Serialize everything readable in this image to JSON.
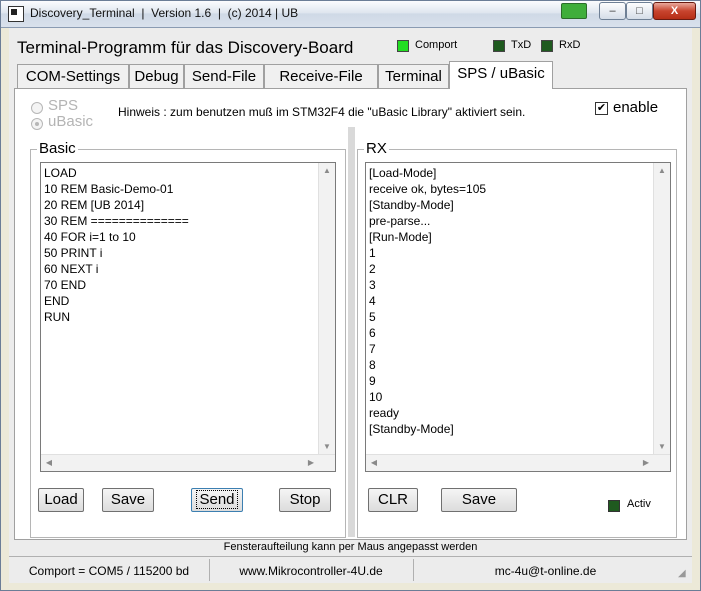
{
  "window": {
    "title": "Discovery_Terminal  |  Version 1.6  |  (c) 2014 | UB",
    "min_label": "–",
    "max_label": "□",
    "close_label": "X"
  },
  "header": {
    "app_title": "Terminal-Programm für das Discovery-Board",
    "indicators": [
      {
        "label": "Comport",
        "color": "#22dd22"
      },
      {
        "label": "TxD",
        "color": "#1f5a1f"
      },
      {
        "label": "RxD",
        "color": "#1f5a1f"
      }
    ]
  },
  "tabs": [
    {
      "label": "COM-Settings"
    },
    {
      "label": "Debug"
    },
    {
      "label": "Send-File"
    },
    {
      "label": "Receive-File"
    },
    {
      "label": "Terminal"
    },
    {
      "label": "SPS / uBasic",
      "active": true
    }
  ],
  "mode": {
    "options": [
      {
        "label": "SPS",
        "checked": false
      },
      {
        "label": "uBasic",
        "checked": true
      }
    ],
    "hint": "Hinweis : zum benutzen muß im STM32F4 die \"uBasic Library\" aktiviert sein.",
    "enable_label": "enable",
    "enable_checked": true,
    "check_glyph": "✔"
  },
  "basic": {
    "title": "Basic",
    "lines": "LOAD\n10 REM Basic-Demo-01\n20 REM [UB 2014]\n30 REM ==============\n40 FOR i=1 to 10\n50 PRINT i\n60 NEXT i\n70 END\nEND\nRUN",
    "buttons": {
      "load": "Load",
      "save": "Save",
      "send": "Send",
      "stop": "Stop"
    }
  },
  "rx": {
    "title": "RX",
    "lines": "[Load-Mode]\nreceive ok, bytes=105\n[Standby-Mode]\npre-parse...\n[Run-Mode]\n1\n2\n3\n4\n5\n6\n7\n8\n9\n10\nready\n[Standby-Mode]",
    "buttons": {
      "clr": "CLR",
      "save": "Save"
    },
    "activ_label": "Activ",
    "activ_color": "#1f5a1f"
  },
  "scroll_arrows": {
    "up": "▲",
    "down": "▼",
    "left": "◀",
    "right": "▶"
  },
  "footer": {
    "hint": "Fensteraufteilung kann per Maus angepasst werden",
    "status": {
      "comport": "Comport = COM5 / 115200 bd",
      "website": "www.Mikrocontroller-4U.de",
      "email": "mc-4u@t-online.de"
    }
  }
}
